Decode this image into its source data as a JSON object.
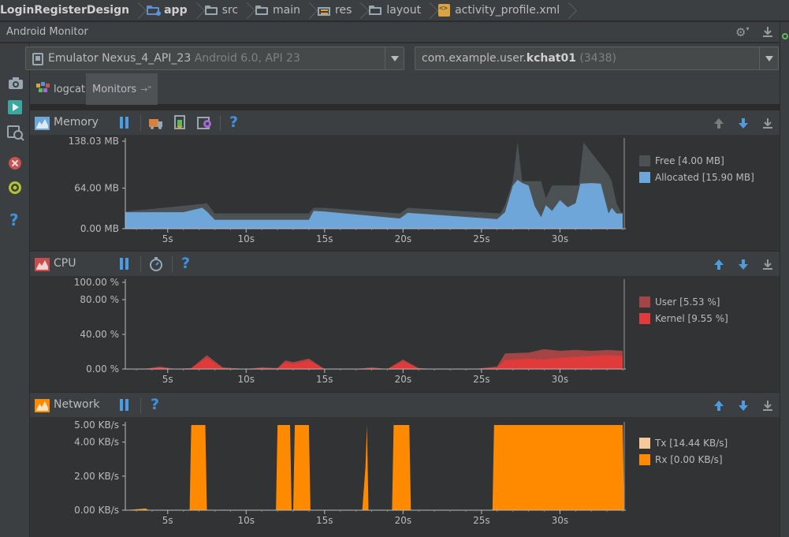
{
  "breadcrumb": [
    {
      "label": "LoginRegisterDesign",
      "icon": "module-icon",
      "bold": true
    },
    {
      "label": "app",
      "icon": "folder-module-icon",
      "bold": true
    },
    {
      "label": "src",
      "icon": "folder-icon"
    },
    {
      "label": "main",
      "icon": "folder-icon"
    },
    {
      "label": "res",
      "icon": "resources-folder-icon"
    },
    {
      "label": "layout",
      "icon": "folder-icon"
    },
    {
      "label": "activity_profile.xml",
      "icon": "xml-file-icon"
    }
  ],
  "tool_window": {
    "title": "Android Monitor"
  },
  "device_selector": {
    "name": "Emulator Nexus_4_API_23",
    "detail": "Android 6.0, API 23"
  },
  "process_selector": {
    "prefix": "com.example.user.",
    "name": "kchat01",
    "pid": "(3438)"
  },
  "tabs": [
    {
      "label": "logcat"
    },
    {
      "label": "Monitors",
      "pin": "→\""
    }
  ],
  "colors": {
    "free": "#4c5153",
    "allocated": "#6ea6da",
    "user": "#a34545",
    "kernel": "#e03a3a",
    "tx": "#f5c999",
    "rx": "#ff8a00",
    "accent": "#4d9be0"
  },
  "memory": {
    "title": "Memory",
    "legend": [
      "Free [4.00 MB]",
      "Allocated [15.90 MB]"
    ]
  },
  "cpu": {
    "title": "CPU",
    "legend": [
      "User [5.53 %]",
      "Kernel [9.55 %]"
    ]
  },
  "network": {
    "title": "Network",
    "legend": [
      "Tx [14.44 KB/s]",
      "Rx [0.00 KB/s]"
    ]
  },
  "chart_data": [
    {
      "type": "area",
      "title": "Memory",
      "x_ticks": [
        "5s",
        "10s",
        "15s",
        "20s",
        "25s",
        "30s"
      ],
      "x_tick_values": [
        5,
        10,
        15,
        20,
        25,
        30
      ],
      "xlim": [
        2.3,
        34.2
      ],
      "y_ticks": [
        "138.03 MB",
        "64.00 MB",
        "0.00 MB"
      ],
      "y_tick_values": [
        138.03,
        64,
        0
      ],
      "ylim": [
        0,
        138.03
      ],
      "series": [
        {
          "name": "Free",
          "x": [
            2.3,
            7.2,
            7.5,
            8.0,
            14.0,
            14.3,
            15.0,
            19.8,
            20.3,
            26.2,
            26.5,
            27.0,
            27.3,
            27.6,
            28.8,
            29.1,
            29.5,
            31.2,
            31.5,
            33.1,
            33.3,
            33.6,
            33.9,
            34.0
          ],
          "y": [
            27,
            39,
            40,
            24,
            24,
            33,
            33,
            24,
            33,
            24,
            37,
            75,
            137,
            75,
            75,
            48,
            68,
            68,
            136,
            85,
            75,
            40,
            26,
            26
          ]
        },
        {
          "name": "Allocated",
          "x": [
            2.3,
            6.0,
            7.2,
            7.5,
            8.0,
            14.0,
            14.3,
            15.0,
            19.8,
            20.3,
            26.0,
            26.5,
            27.0,
            27.3,
            27.6,
            28.0,
            28.4,
            28.8,
            29.1,
            29.5,
            30.0,
            30.5,
            31.0,
            31.3,
            32.0,
            32.6,
            33.1,
            33.3,
            33.6,
            34.0
          ],
          "y": [
            26,
            26,
            33,
            27,
            14,
            14,
            28,
            27,
            16,
            25,
            15,
            26,
            68,
            77,
            72,
            68,
            35,
            18,
            37,
            28,
            45,
            34,
            40,
            71,
            72,
            71,
            24,
            33,
            24,
            24
          ]
        }
      ]
    },
    {
      "type": "area",
      "title": "CPU",
      "x_ticks": [
        "5s",
        "10s",
        "15s",
        "20s",
        "25s",
        "30s"
      ],
      "x_tick_values": [
        5,
        10,
        15,
        20,
        25,
        30
      ],
      "xlim": [
        2.3,
        34.2
      ],
      "y_ticks": [
        "100.00 %",
        "80.00 %",
        "40.00 %",
        "0.00 %"
      ],
      "y_tick_values": [
        100,
        80,
        40,
        0
      ],
      "ylim": [
        0,
        100
      ],
      "series": [
        {
          "name": "User",
          "x": [
            2.3,
            3.5,
            4.5,
            5.5,
            6.5,
            7.5,
            8.5,
            10.0,
            11.0,
            12.0,
            12.5,
            13.0,
            14.0,
            15.0,
            16.0,
            17.0,
            18.0,
            19.0,
            20.0,
            21.0,
            22.0,
            24.5,
            25.5,
            26.0,
            26.5,
            28.0,
            29.0,
            30.0,
            31.0,
            32.0,
            33.0,
            34.0
          ],
          "y": [
            0,
            0,
            3,
            0,
            1,
            16,
            2,
            0,
            2,
            1,
            10,
            8,
            12,
            0,
            0,
            0,
            2,
            0,
            11,
            1,
            0,
            0,
            2,
            3,
            18,
            19,
            23,
            21,
            22,
            21,
            22,
            21
          ]
        },
        {
          "name": "Kernel",
          "x": [
            2.3,
            3.5,
            4.5,
            5.5,
            6.5,
            7.5,
            8.5,
            10.0,
            11.0,
            12.0,
            12.5,
            13.0,
            14.0,
            15.0,
            16.0,
            17.0,
            18.0,
            19.0,
            20.0,
            21.0,
            22.0,
            24.5,
            25.5,
            26.0,
            26.5,
            28.0,
            29.0,
            30.0,
            31.0,
            32.0,
            33.0,
            34.0
          ],
          "y": [
            0,
            0,
            2,
            0,
            1,
            13,
            1,
            0,
            1,
            1,
            8,
            6,
            10,
            0,
            0,
            0,
            1,
            0,
            9,
            1,
            0,
            0,
            1,
            2,
            10,
            12,
            11,
            13,
            14,
            15,
            16,
            15
          ]
        }
      ]
    },
    {
      "type": "area",
      "title": "Network",
      "x_ticks": [
        "5s",
        "10s",
        "15s",
        "20s",
        "25s",
        "30s"
      ],
      "x_tick_values": [
        5,
        10,
        15,
        20,
        25,
        30
      ],
      "xlim": [
        2.3,
        34.2
      ],
      "y_ticks": [
        "5.00 KB/s",
        "4.00 KB/s",
        "2.00 KB/s",
        "0.00 KB/s"
      ],
      "y_tick_values": [
        5,
        4,
        2,
        0
      ],
      "ylim": [
        0,
        5
      ],
      "series": [
        {
          "name": "Tx",
          "x": [
            2.3,
            34.2
          ],
          "y": [
            0,
            0
          ]
        },
        {
          "name": "Rx",
          "x": [
            2.3,
            3.6,
            3.8,
            6.4,
            6.5,
            7.4,
            7.5,
            11.9,
            12.0,
            12.8,
            12.9,
            13.0,
            13.1,
            14.0,
            14.1,
            17.4,
            17.6,
            17.7,
            17.8,
            19.3,
            19.4,
            20.4,
            20.5,
            25.7,
            25.8,
            34.0,
            34.1
          ],
          "y": [
            0,
            0.1,
            0,
            0,
            5,
            5,
            0,
            0,
            5,
            5,
            0,
            0,
            5,
            5,
            0,
            0,
            2.5,
            5,
            0,
            0,
            5,
            5,
            0,
            0,
            5,
            5,
            0
          ]
        }
      ]
    }
  ]
}
